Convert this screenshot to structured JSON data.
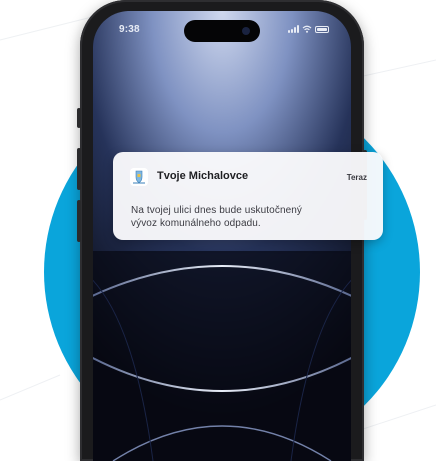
{
  "status_bar": {
    "time": "9:38"
  },
  "notification": {
    "app_name": "Tvoje Michalovce",
    "time": "Teraz",
    "body_line_1": "Na tvojej ulici dnes bude uskutočnený",
    "body_line_2": "vývoz komunálneho odpadu.",
    "icon": "city-crest-icon"
  },
  "colors": {
    "accent_circle": "#0aa5db",
    "phone_frame": "#1b1b1d",
    "notification_bg": "#fafafc"
  }
}
